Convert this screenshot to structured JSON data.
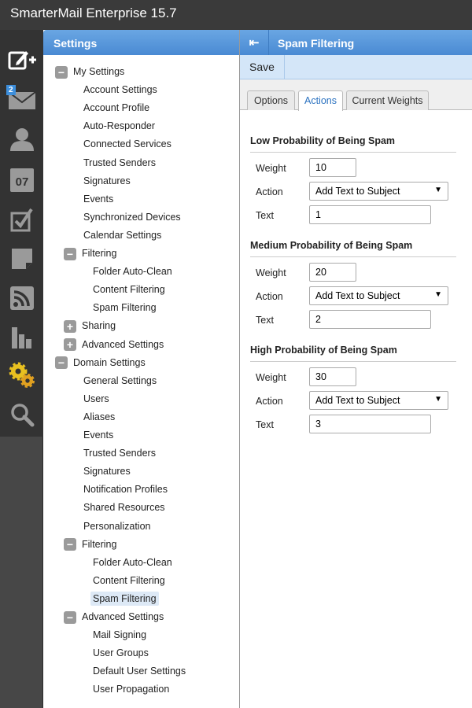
{
  "app": {
    "title": "SmarterMail Enterprise 15.7"
  },
  "nav": {
    "mail_badge": "2",
    "calendar_day": "07",
    "icons": [
      "compose-icon",
      "mail-icon",
      "contacts-icon",
      "calendar-icon",
      "tasks-icon",
      "notes-icon",
      "rss-icon",
      "reports-icon",
      "settings-icon",
      "search-icon"
    ]
  },
  "settings": {
    "title": "Settings",
    "tree": [
      {
        "label": "My Settings",
        "level": 0,
        "exp": "minus"
      },
      {
        "label": "Account Settings",
        "level": 1
      },
      {
        "label": "Account Profile",
        "level": 1
      },
      {
        "label": "Auto-Responder",
        "level": 1
      },
      {
        "label": "Connected Services",
        "level": 1
      },
      {
        "label": "Trusted Senders",
        "level": 1
      },
      {
        "label": "Signatures",
        "level": 1
      },
      {
        "label": "Events",
        "level": 1
      },
      {
        "label": "Synchronized Devices",
        "level": 1
      },
      {
        "label": "Calendar Settings",
        "level": 1
      },
      {
        "label": "Filtering",
        "level": 1,
        "exp": "minus"
      },
      {
        "label": "Folder Auto-Clean",
        "level": 2
      },
      {
        "label": "Content Filtering",
        "level": 2
      },
      {
        "label": "Spam Filtering",
        "level": 2
      },
      {
        "label": "Sharing",
        "level": 1,
        "exp": "plus"
      },
      {
        "label": "Advanced Settings",
        "level": 1,
        "exp": "plus"
      },
      {
        "label": "Domain Settings",
        "level": 0,
        "exp": "minus"
      },
      {
        "label": "General Settings",
        "level": 1
      },
      {
        "label": "Users",
        "level": 1
      },
      {
        "label": "Aliases",
        "level": 1
      },
      {
        "label": "Events",
        "level": 1
      },
      {
        "label": "Trusted Senders",
        "level": 1
      },
      {
        "label": "Signatures",
        "level": 1
      },
      {
        "label": "Notification Profiles",
        "level": 1
      },
      {
        "label": "Shared Resources",
        "level": 1
      },
      {
        "label": "Personalization",
        "level": 1
      },
      {
        "label": "Filtering",
        "level": 1,
        "exp": "minus"
      },
      {
        "label": "Folder Auto-Clean",
        "level": 2
      },
      {
        "label": "Content Filtering",
        "level": 2
      },
      {
        "label": "Spam Filtering",
        "level": 2,
        "selected": true
      },
      {
        "label": "Advanced Settings",
        "level": 1,
        "exp": "minus"
      },
      {
        "label": "Mail Signing",
        "level": 2
      },
      {
        "label": "User Groups",
        "level": 2
      },
      {
        "label": "Default User Settings",
        "level": 2
      },
      {
        "label": "User Propagation",
        "level": 2
      }
    ]
  },
  "main": {
    "title": "Spam Filtering",
    "save_label": "Save",
    "tabs": [
      {
        "label": "Options"
      },
      {
        "label": "Actions",
        "active": true
      },
      {
        "label": "Current Weights"
      }
    ],
    "labels": {
      "weight": "Weight",
      "action": "Action",
      "text": "Text"
    },
    "sections": [
      {
        "heading": "Low Probability of Being Spam",
        "weight": "10",
        "action": "Add Text to Subject",
        "text": "1"
      },
      {
        "heading": "Medium Probability of Being Spam",
        "weight": "20",
        "action": "Add Text to Subject",
        "text": "2"
      },
      {
        "heading": "High Probability of Being Spam",
        "weight": "30",
        "action": "Add Text to Subject",
        "text": "3"
      }
    ]
  },
  "colors": {
    "accent": "#4a8ad3",
    "topbar": "#3a3a3a",
    "active_tab_text": "#2b72c0"
  }
}
